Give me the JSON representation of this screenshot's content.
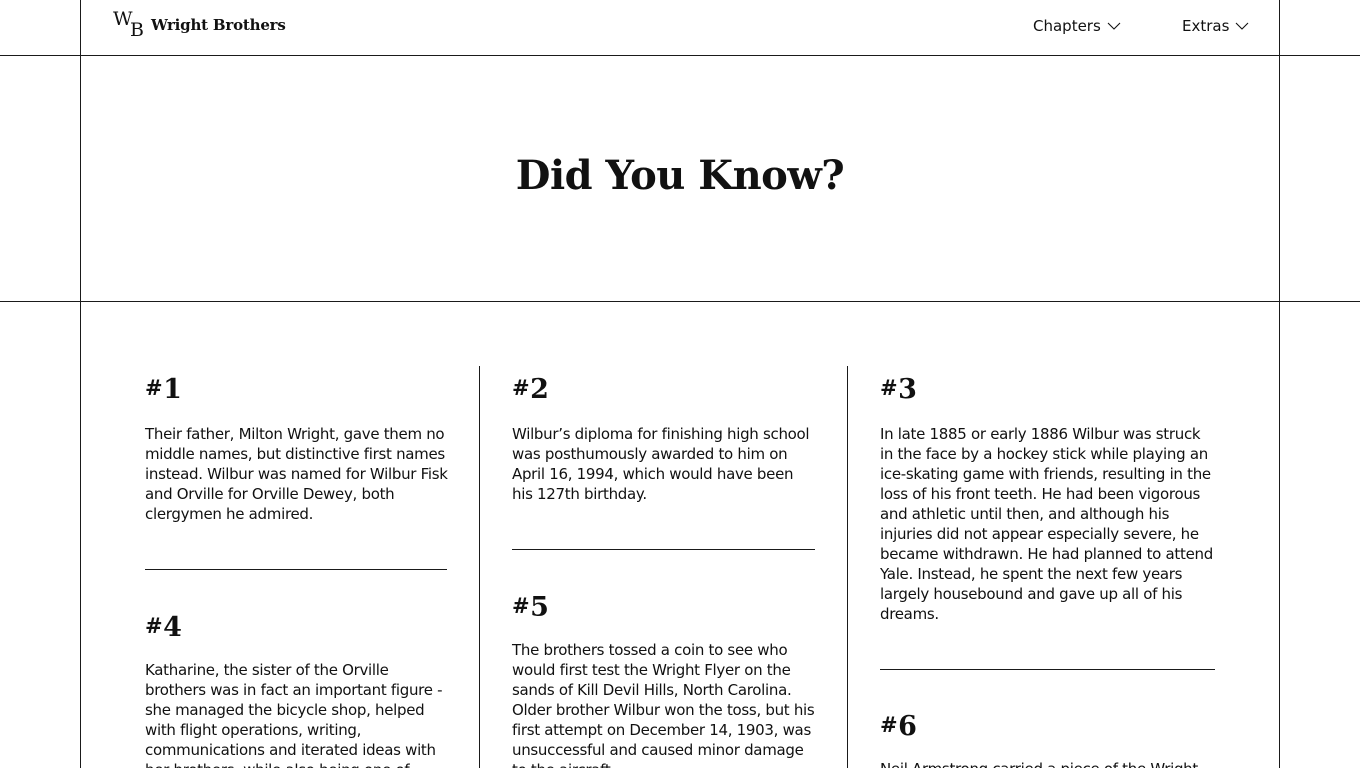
{
  "header": {
    "logo_mark_w": "W",
    "logo_mark_b": "B",
    "logo_text": "Wright Brothers",
    "nav": [
      {
        "label": "Chapters",
        "icon": "chevron-down-icon"
      },
      {
        "label": "Extras",
        "icon": "chevron-down-icon"
      }
    ]
  },
  "hero": {
    "title": "Did You Know?"
  },
  "facts": [
    {
      "number": "1",
      "text": "Their father, Milton Wright, gave them no middle names, but distinctive first names instead. Wilbur was named for Wilbur Fisk and Orville for Orville Dewey, both clergymen he admired."
    },
    {
      "number": "2",
      "text": "Wilbur’s diploma for finishing high school was posthumously awarded to him on April 16, 1994, which would have been his 127th birthday."
    },
    {
      "number": "3",
      "text": "In late 1885 or early 1886 Wilbur was struck in the face by a hockey stick while playing an ice-skating game with friends, resulting in the loss of his front teeth. He had been vigorous and athletic until then, and although his injuries did not appear especially severe, he became withdrawn. He had planned to attend Yale. Instead, he spent the next few years largely housebound and gave up all of his dreams."
    },
    {
      "number": "4",
      "text": "Katharine, the sister of the Orville brothers was in fact an important figure - she managed the bicycle shop, helped with flight operations, writing, communications and iterated ideas with her brothers, while also being one of them"
    },
    {
      "number": "5",
      "text": "The brothers tossed a coin to see who would first test the Wright Flyer on the sands of Kill Devil Hills, North Carolina. Older brother Wilbur won the toss, but his first attempt on December 14, 1903, was unsuccessful and caused minor damage to the aircraft."
    },
    {
      "number": "6",
      "text": "Neil Armstrong carried a piece of the Wright"
    }
  ],
  "colors": {
    "background": "#ffffff",
    "text": "#111111",
    "lines": "#1a1a1a"
  }
}
